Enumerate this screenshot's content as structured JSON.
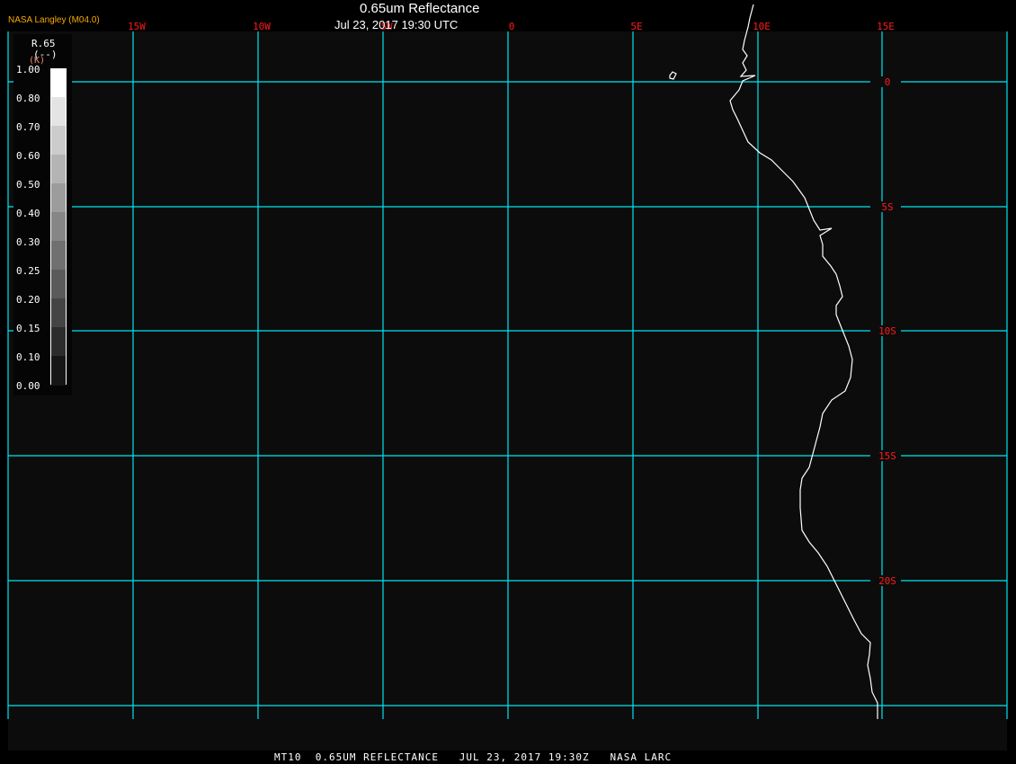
{
  "header": {
    "title": "0.65um Reflectance",
    "datetime": "Jul 23, 2017 19:30 UTC",
    "brand": "NASA Langley (M04.0)"
  },
  "legend": {
    "variable": "R.65",
    "unit": "(--)",
    "unit_k": "(K)",
    "ticks": [
      "1.00",
      "0.80",
      "0.70",
      "0.60",
      "0.50",
      "0.40",
      "0.30",
      "0.25",
      "0.20",
      "0.15",
      "0.10",
      "0.00"
    ],
    "colors": [
      "#ffffff",
      "#e4e4e4",
      "#cccccc",
      "#b4b4b4",
      "#9c9c9c",
      "#868686",
      "#707070",
      "#5a5a5a",
      "#444444",
      "#2c2c2c",
      "#161616"
    ]
  },
  "map": {
    "background": "#0c0c0c",
    "grid_color": "#00e5f0",
    "label_color": "#ff1a1a",
    "coast_color": "#ffffff",
    "lon_labels": [
      "15W",
      "10W",
      "5W",
      "0",
      "5E",
      "10E",
      "15E"
    ],
    "lat_labels": [
      "0",
      "5S",
      "10S",
      "15S",
      "20S"
    ]
  },
  "footer": {
    "caption": "MT10  0.65UM REFLECTANCE   JUL 23, 2017 19:30Z   NASA LARC"
  }
}
